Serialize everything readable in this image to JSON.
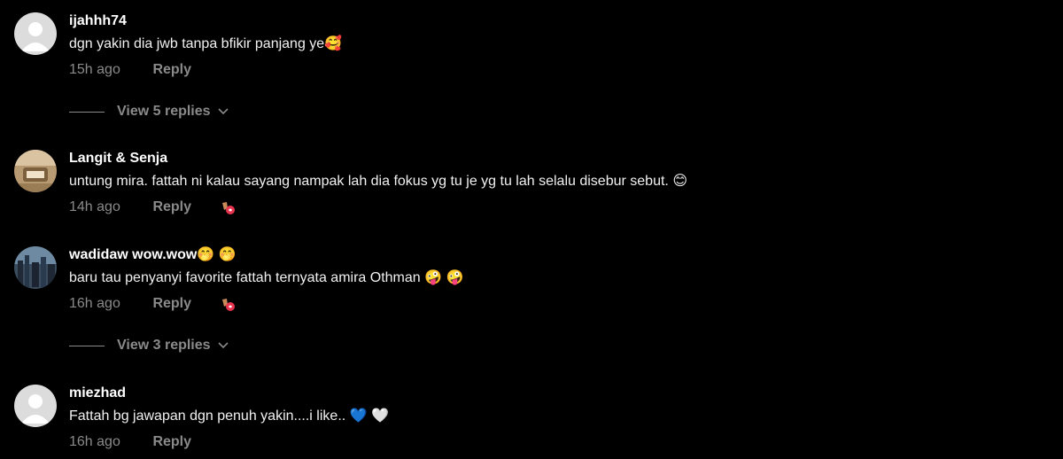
{
  "comments": [
    {
      "username": "ijahhh74",
      "text": "dgn yakin dia jwb tanpa bfikir panjang ye",
      "emojis": "🥰",
      "time": "15h ago",
      "reply": "Reply",
      "avatar": "default"
    },
    {
      "username": "Langit & Senja",
      "text": "untung mira. fattah ni kalau sayang nampak lah dia fokus yg tu je yg tu lah selalu disebur sebut.",
      "emojis": "😊",
      "time": "14h ago",
      "reply": "Reply",
      "avatar": "photo"
    },
    {
      "username": "wadidaw wow.wow",
      "username_emojis": "🤭 🤭",
      "text": "baru tau penyanyi favorite fattah ternyata amira Othman",
      "emojis": "🤪 🤪",
      "time": "16h ago",
      "reply": "Reply",
      "avatar": "photo"
    },
    {
      "username": "miezhad",
      "text": "Fattah bg jawapan dgn penuh yakin....i like..",
      "emojis": "💙 🤍",
      "time": "16h ago",
      "reply": "Reply",
      "avatar": "default"
    }
  ],
  "view_replies": [
    {
      "label": "View 5 replies"
    },
    {
      "label": "View 3 replies"
    }
  ],
  "colors": {
    "background": "#000000",
    "muted": "#8a8a8a",
    "text": "#ffffff"
  }
}
